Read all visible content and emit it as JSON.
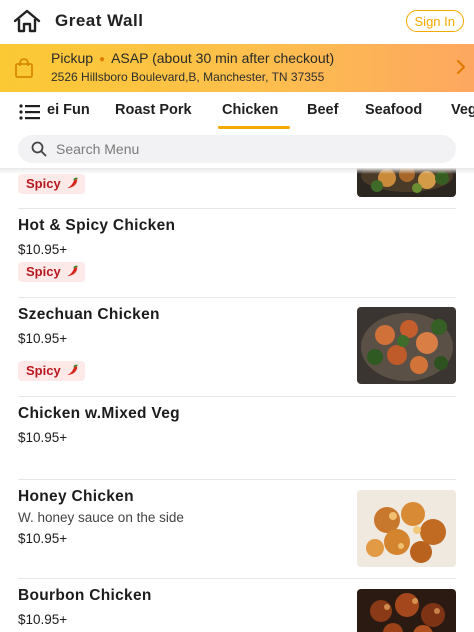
{
  "header": {
    "store_name": "Great Wall",
    "sign_in_label": "Sign In"
  },
  "banner": {
    "mode": "Pickup",
    "time": "ASAP (about 30 min after checkout)",
    "address": "2526 Hillsboro Boulevard,B, Manchester, TN 37355"
  },
  "categories": {
    "tabs": [
      "ei Fun",
      "Roast Pork",
      "Chicken",
      "Beef",
      "Seafood",
      "Veg"
    ],
    "active": "Chicken"
  },
  "search": {
    "placeholder": "Search Menu"
  },
  "items": [
    {
      "name": "",
      "desc": "",
      "price": "",
      "badge": "Spicy"
    },
    {
      "name": "Hot & Spicy Chicken",
      "desc": "",
      "price": "$10.95+",
      "badge": "Spicy"
    },
    {
      "name": "Szechuan Chicken",
      "desc": "",
      "price": "$10.95+",
      "badge": "Spicy"
    },
    {
      "name": "Chicken w.Mixed Veg",
      "desc": "",
      "price": "$10.95+",
      "badge": ""
    },
    {
      "name": "Honey Chicken",
      "desc": "W. honey sauce on the side",
      "price": "$10.95+",
      "badge": ""
    },
    {
      "name": "Bourbon Chicken",
      "desc": "",
      "price": "$10.95+",
      "badge": ""
    }
  ],
  "colors": {
    "accent": "#f4a900",
    "spicy_text": "#b8181f",
    "spicy_bg": "#fde9e8"
  },
  "icons": {
    "home": "home-icon",
    "bag": "shopping-bag-icon",
    "menu": "menu-list-icon",
    "search": "search-icon",
    "chili": "chili-pepper-icon"
  }
}
